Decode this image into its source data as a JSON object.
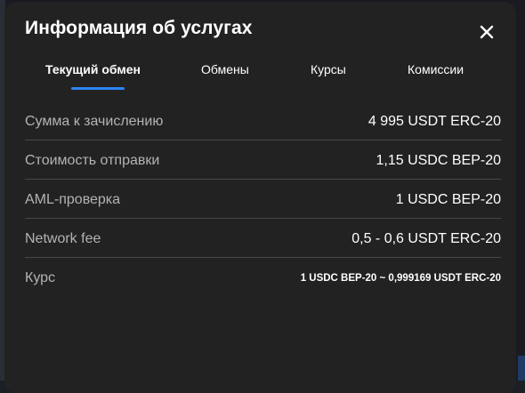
{
  "modal": {
    "title": "Информация об услугах",
    "close_icon": "close-icon"
  },
  "tabs": [
    {
      "label": "Текущий обмен",
      "active": true
    },
    {
      "label": "Обмены",
      "active": false
    },
    {
      "label": "Курсы",
      "active": false
    },
    {
      "label": "Комиссии",
      "active": false
    }
  ],
  "rows": [
    {
      "label": "Сумма к зачислению",
      "value": "4 995 USDT ERC-20"
    },
    {
      "label": "Стоимость отправки",
      "value": "1,15 USDC BEP-20"
    },
    {
      "label": "AML-проверка",
      "value": "1 USDC BEP-20"
    },
    {
      "label": "Network fee",
      "value": "0,5 - 0,6 USDT ERC-20"
    },
    {
      "label": "Курс",
      "value": "1 USDC BEP-20 ~ 0,999169 USDT ERC-20"
    }
  ],
  "colors": {
    "modal_background": "#222222",
    "accent": "#2c86f5",
    "label_text": "#b3b3b3",
    "value_text": "#ffffff",
    "divider": "#474747"
  }
}
